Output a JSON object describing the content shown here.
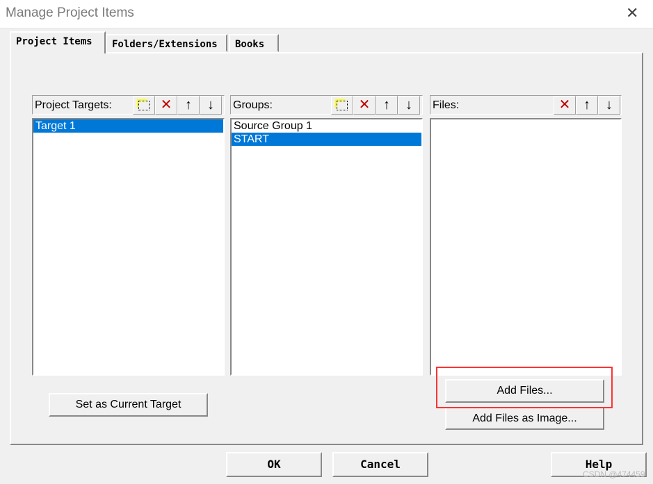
{
  "window": {
    "title": "Manage Project Items",
    "close": "✕"
  },
  "tabs": [
    {
      "label": "Project Items",
      "active": true
    },
    {
      "label": "Folders/Extensions"
    },
    {
      "label": "Books"
    }
  ],
  "targets": {
    "label": "Project Targets:",
    "items": [
      "Target 1"
    ],
    "selected": 0
  },
  "groups": {
    "label": "Groups:",
    "items": [
      "Source Group 1",
      "START"
    ],
    "selected": 1
  },
  "files": {
    "label": "Files:",
    "items": []
  },
  "icons": {
    "new": "new-item-icon",
    "delete": "✕",
    "up": "🡅",
    "down": "🡇"
  },
  "buttons": {
    "set_current": "Set as Current Target",
    "add_files": "Add Files...",
    "add_image": "Add Files as Image...",
    "ok": "OK",
    "cancel": "Cancel",
    "help": "Help"
  },
  "watermark": "CSDN @474459",
  "colors": {
    "selection": "#0078d7",
    "highlight_box": "#ff3333",
    "delete": "#c00000"
  }
}
